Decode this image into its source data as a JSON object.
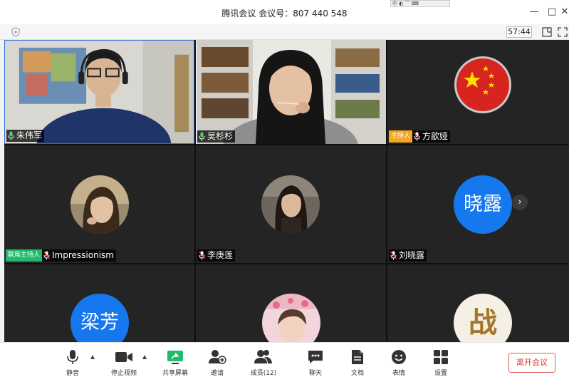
{
  "window": {
    "title": "腾讯会议 会议号：807 440 548",
    "ime_strip": "中 ◐ ⌒ ⌨",
    "minimize": "—",
    "maximize": "□",
    "close": "✕"
  },
  "subbar": {
    "timer": "57:44"
  },
  "participants": [
    {
      "name": "朱伟军",
      "mic": "on",
      "role": ""
    },
    {
      "name": "吴杉杉",
      "mic": "on",
      "role": ""
    },
    {
      "name": "方歆娅",
      "mic": "muted",
      "role": "主持人"
    },
    {
      "name": "Impressionism",
      "mic": "muted",
      "role": "联席主持人"
    },
    {
      "name": "李庚莲",
      "mic": "muted",
      "role": ""
    },
    {
      "name": "刘晓露",
      "mic": "muted",
      "role": ""
    },
    {
      "name": "",
      "mic": "",
      "role": ""
    },
    {
      "name": "",
      "mic": "",
      "role": ""
    },
    {
      "name": "",
      "mic": "",
      "role": ""
    }
  ],
  "avatars": {
    "liu_xiaolu": "晓露",
    "liang_fang": "梁芳",
    "zhan": "战"
  },
  "colors": {
    "accent_blue": "#1678ee",
    "host_badge": "#f5a623",
    "cohost_badge": "#1fba6a",
    "leave_red": "#e23b3b"
  },
  "pager_arrow": "›",
  "toolbar": {
    "mute": "静音",
    "stop_video": "停止视频",
    "share_screen": "共享屏幕",
    "invite": "邀请",
    "members": "成员(12)",
    "chat": "聊天",
    "docs": "文档",
    "reactions": "表情",
    "settings": "设置",
    "leave": "离开会议",
    "caret": "▲"
  }
}
